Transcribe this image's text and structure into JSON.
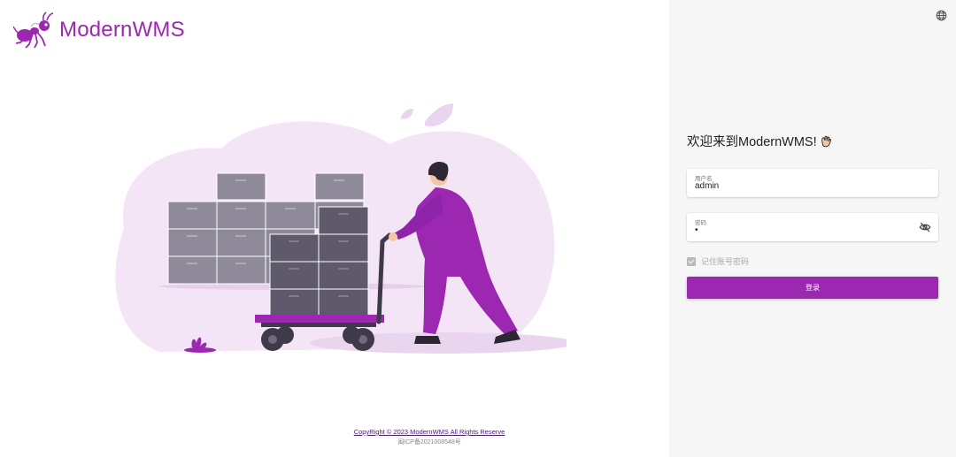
{
  "brand": {
    "name": "ModernWMS",
    "logo_icon": "ant-logo-icon",
    "color": "#9c27b0"
  },
  "footer": {
    "copyright": "CopyRight © 2023 ModernWMS All Rights Reserve",
    "icp": "闽ICP备2021008548号"
  },
  "header": {
    "language_icon": "globe-icon"
  },
  "login": {
    "welcome": "欢迎来到ModernWMS!",
    "welcome_icon": "waving-hand-icon",
    "username": {
      "label": "用户名",
      "value": "admin"
    },
    "password": {
      "label": "密码",
      "value": "•",
      "toggle_icon": "eye-off-icon"
    },
    "remember": {
      "label": "记住账号密码",
      "checked": true
    },
    "submit_label": "登录"
  },
  "illustration": {
    "name": "warehouse-worker-pushing-cart-illustration"
  }
}
